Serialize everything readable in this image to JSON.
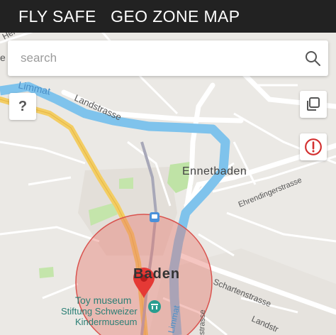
{
  "header": {
    "title": "FLY SAFE   GEO ZONE MAP"
  },
  "search": {
    "placeholder": "search"
  },
  "controls": {
    "help_label": "?"
  },
  "map": {
    "labels": {
      "limmat_top": "Limmat",
      "landstrasse_top": "Landstrasse",
      "ennetbaden": "Ennetbaden",
      "ehrendingerstrasse": "Ehrendingerstrasse",
      "baden": "Baden",
      "schartenstrasse": "Schartenstrasse",
      "toy_museum": "Toy museum",
      "stiftung": "Stiftung Schweizer",
      "kindermuseum": "Kindermuseum",
      "limmat_bottom": "Limmat",
      "strasse_vertical": "strasse",
      "landstrasse_bottom": "Landstr",
      "herte_partial": "Herte",
      "e_partial": "e"
    },
    "colors": {
      "river": "#7fc3ec",
      "zone_fill": "#e8766c",
      "zone_stroke": "#d9534f",
      "pin": "#e53935",
      "road_yellow": "#f3cd63",
      "alert": "#d32f2f"
    }
  }
}
